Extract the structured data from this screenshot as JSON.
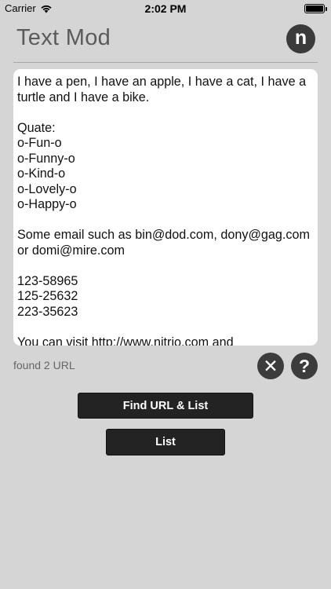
{
  "status_bar": {
    "carrier": "Carrier",
    "time": "2:02 PM",
    "wifi_icon": "wifi-icon",
    "battery_icon": "battery-icon"
  },
  "header": {
    "title": "Text Mod",
    "logo_letter": "n"
  },
  "editor": {
    "text": "I have a pen, I have an apple, I have a cat, I have a turtle and I have a bike.\n\nQuate:\no-Fun-o\no-Funny-o\no-Kind-o\no-Lovely-o\no-Happy-o\n\nSome email such as bin@dod.com, dony@gag.com or domi@mire.com\n\n123-58965\n125-25632\n223-35623\n\nYou can visit http://www.nitrio.com and"
  },
  "result": {
    "found_label": "found 2 URL"
  },
  "controls": {
    "clear_glyph": "✕",
    "help_glyph": "?",
    "find_url_label": "Find URL & List",
    "list_label": "List"
  },
  "colors": {
    "background": "#d5d5d5",
    "button": "#232323",
    "title": "#5b5b5b"
  }
}
